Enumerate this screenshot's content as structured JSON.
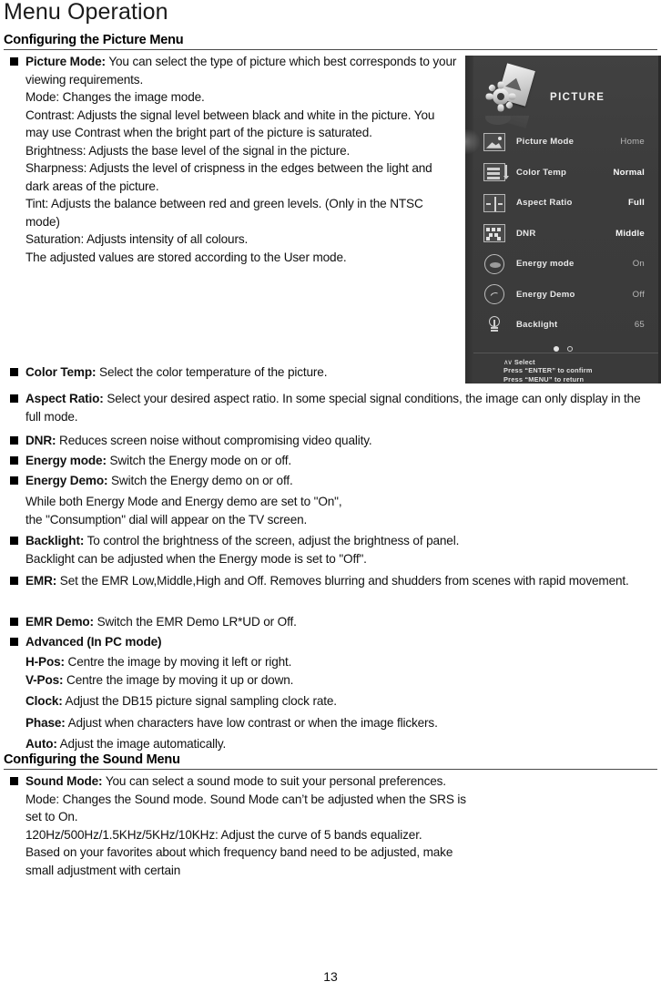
{
  "page": {
    "title": "Menu Operation",
    "number": "13"
  },
  "sections": {
    "picture_heading": "Configuring the Picture Menu",
    "sound_heading": "Configuring the Sound Menu"
  },
  "picture": {
    "picture_mode": {
      "term": "Picture Mode:",
      "desc": "You can select the type of picture which best corresponds to your viewing requirements.",
      "lines": [
        "Mode: Changes the image mode.",
        "Contrast: Adjusts the signal level between black and white in the picture. You may use Contrast when the bright part of the picture is saturated.",
        "Brightness: Adjusts the base level of the signal in the picture.",
        "Sharpness: Adjusts the level of crispness in the edges between the light and dark areas of the picture.",
        "Tint: Adjusts the balance between red and green levels. (Only in the NTSC mode)",
        "Saturation: Adjusts intensity of all colours.",
        "The adjusted values are stored according to the User mode."
      ]
    },
    "color_temp": {
      "term": "Color Temp:",
      "desc": "Select the color temperature of the picture."
    },
    "aspect_ratio": {
      "term": "Aspect Ratio:",
      "desc": "Select your desired aspect ratio. In some special signal conditions, the image can only display in the full mode."
    },
    "dnr": {
      "term": "DNR:",
      "desc": "Reduces screen noise without compromising video quality."
    },
    "energy_mode": {
      "term": "Energy mode:",
      "desc": "Switch the Energy mode on or off."
    },
    "energy_demo": {
      "term": "Energy Demo:",
      "desc": "Switch the Energy demo on or off.",
      "note_line1": "While both Energy Mode and Energy demo are set to \"On\",",
      "note_line2": "the \"Consumption\" dial will appear on the TV screen."
    },
    "backlight": {
      "term": "Backlight:",
      "desc": "To control the brightness of the screen, adjust the brightness of panel.",
      "note": "Backlight can be adjusted when the Energy mode is set to \"Off\"."
    },
    "emr": {
      "term": "EMR:",
      "desc": "Set the EMR Low,Middle,High and Off. Removes blurring and shudders from scenes with rapid movement."
    },
    "emr_demo": {
      "term": "EMR Demo:",
      "desc": "Switch the EMR Demo LR*UD or Off."
    },
    "advanced": {
      "term": "Advanced (In PC mode)",
      "items": [
        {
          "term": "H-Pos:",
          "desc": "Centre the image by moving it left or right."
        },
        {
          "term": "V-Pos:",
          "desc": "Centre the image by moving it up or down."
        },
        {
          "term": "Clock:",
          "desc": "Adjust the DB15 picture signal sampling clock rate."
        },
        {
          "term": "Phase:",
          "desc": "Adjust when characters have low contrast or when the image flickers."
        },
        {
          "term": "Auto:",
          "desc": "Adjust the image automatically."
        }
      ]
    }
  },
  "sound": {
    "sound_mode": {
      "term": "Sound Mode:",
      "desc": "You can select a sound mode to suit your personal preferences.",
      "lines": [
        "Mode: Changes the Sound mode. Sound Mode can’t be adjusted when the SRS is set to On.",
        "120Hz/500Hz/1.5KHz/5KHz/10KHz: Adjust the curve of 5 bands equalizer.",
        "Based on your favorites about which frequency band need to be adjusted, make small adjustment with certain"
      ]
    }
  },
  "osd": {
    "title": "PICTURE",
    "header_icon": "picture-settings-icon",
    "rows": [
      {
        "icon": "picture-mode-icon",
        "label": "Picture Mode",
        "value": "Home",
        "value_style": "dim",
        "selected": true
      },
      {
        "icon": "color-temp-icon",
        "label": "Color Temp",
        "value": "Normal",
        "value_style": "brt",
        "selected": false
      },
      {
        "icon": "aspect-ratio-icon",
        "label": "Aspect Ratio",
        "value": "Full",
        "value_style": "brt",
        "selected": false
      },
      {
        "icon": "dnr-icon",
        "label": "DNR",
        "value": "Middle",
        "value_style": "brt",
        "selected": false
      },
      {
        "icon": "energy-mode-icon",
        "label": "Energy mode",
        "value": "On",
        "value_style": "dim",
        "selected": false
      },
      {
        "icon": "energy-demo-icon",
        "label": "Energy Demo",
        "value": "Off",
        "value_style": "dim",
        "selected": false
      },
      {
        "icon": "backlight-icon",
        "label": "Backlight",
        "value": "65",
        "value_style": "dim",
        "selected": false
      }
    ],
    "pager": {
      "total": 2,
      "active": 1
    },
    "footer": {
      "select": "Select",
      "confirm": "Press “ENTER” to confirm",
      "return": "Press “MENU” to return"
    },
    "colors": {
      "panel_bg": "#3c3c3c",
      "label": "#e9e9e9",
      "value_bright": "#fbfbfb",
      "value_dim": "#b9b9b9"
    }
  }
}
